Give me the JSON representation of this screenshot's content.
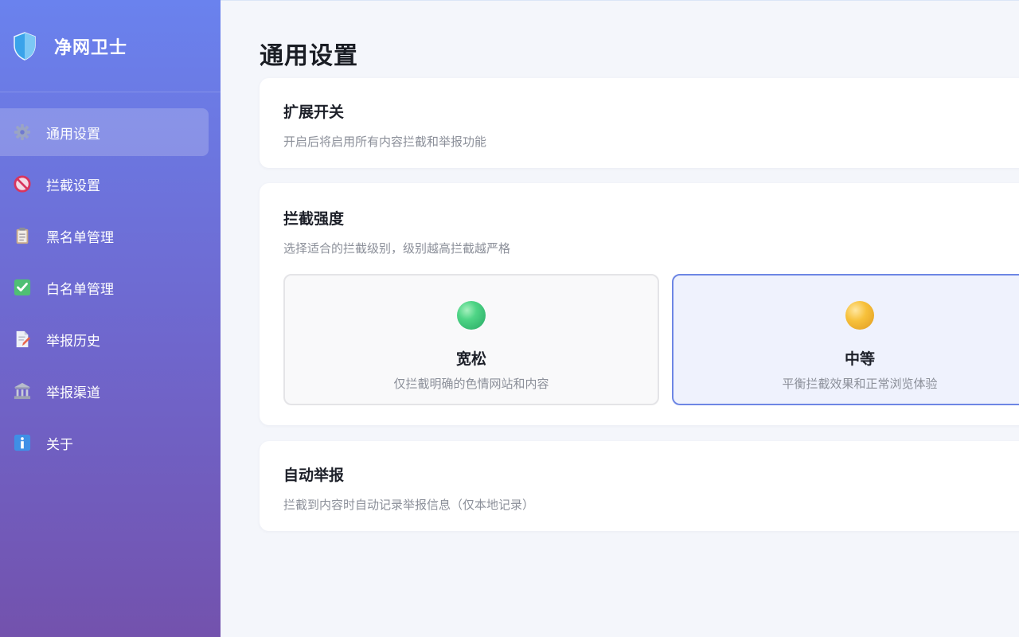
{
  "app": {
    "name": "净网卫士"
  },
  "sidebar": {
    "items": [
      {
        "label": "通用设置",
        "icon": "gear-icon",
        "active": true
      },
      {
        "label": "拦截设置",
        "icon": "prohibited-icon"
      },
      {
        "label": "黑名单管理",
        "icon": "clipboard-icon"
      },
      {
        "label": "白名单管理",
        "icon": "checkbox-icon"
      },
      {
        "label": "举报历史",
        "icon": "document-pen-icon"
      },
      {
        "label": "举报渠道",
        "icon": "bank-icon"
      },
      {
        "label": "关于",
        "icon": "info-icon"
      }
    ]
  },
  "main": {
    "title": "通用设置",
    "extension_switch": {
      "title": "扩展开关",
      "desc": "开启后将启用所有内容拦截和举报功能"
    },
    "strength": {
      "title": "拦截强度",
      "desc": "选择适合的拦截级别，级别越高拦截越严格",
      "levels": [
        {
          "name": "宽松",
          "desc": "仅拦截明确的色情网站和内容",
          "color": "#3fcf7c",
          "selected": false
        },
        {
          "name": "中等",
          "desc": "平衡拦截效果和正常浏览体验",
          "color": "#f4b934",
          "selected": true
        }
      ]
    },
    "auto_report": {
      "title": "自动举报",
      "desc": "拦截到内容时自动记录举报信息（仅本地记录）"
    }
  },
  "colors": {
    "sidebar_top": "#6a82ee",
    "sidebar_bottom": "#7352ad",
    "selected_border": "#6d86e4",
    "background": "#f4f6fb"
  }
}
